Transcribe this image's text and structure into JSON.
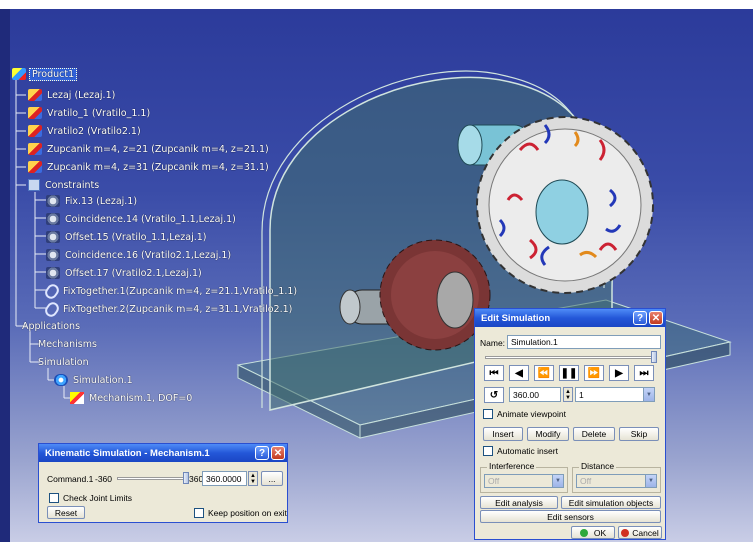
{
  "tree": {
    "root": "Product1",
    "items": [
      {
        "label": "Lezaj (Lezaj.1)",
        "icon": "part-icon"
      },
      {
        "label": "Vratilo_1 (Vratilo_1.1)",
        "icon": "part-icon"
      },
      {
        "label": "Vratilo2 (Vratilo2.1)",
        "icon": "part-icon"
      },
      {
        "label": "Zupcanik  m=4, z=21 (Zupcanik  m=4, z=21.1)",
        "icon": "part-icon"
      },
      {
        "label": "Zupcanik  m=4, z=31 (Zupcanik  m=4, z=31.1)",
        "icon": "part-icon"
      }
    ],
    "constraints_label": "Constraints",
    "constraints": [
      {
        "label": "Fix.13 (Lezaj.1)",
        "icon": "fix-constraint-icon"
      },
      {
        "label": "Coincidence.14 (Vratilo_1.1,Lezaj.1)",
        "icon": "coincidence-constraint-icon"
      },
      {
        "label": "Offset.15 (Vratilo_1.1,Lezaj.1)",
        "icon": "offset-constraint-icon"
      },
      {
        "label": "Coincidence.16 (Vratilo2.1,Lezaj.1)",
        "icon": "coincidence-constraint-icon"
      },
      {
        "label": "Offset.17 (Vratilo2.1,Lezaj.1)",
        "icon": "offset-constraint-icon"
      },
      {
        "label": "FixTogether.1(Zupcanik  m=4, z=21.1,Vratilo_1.1)",
        "icon": "fix-together-icon"
      },
      {
        "label": "FixTogether.2(Zupcanik  m=4, z=31.1,Vratilo2.1)",
        "icon": "fix-together-icon"
      }
    ],
    "applications_label": "Applications",
    "mechanisms_label": "Mechanisms",
    "simulation_label": "Simulation",
    "simulation_item": "Simulation.1",
    "mechanism_item": "Mechanism.1, DOF=0"
  },
  "kinematic_dialog": {
    "title": "Kinematic Simulation - Mechanism.1",
    "command_label": "Command.1",
    "min_value": "-360",
    "max_value": "360",
    "current_value": "360.0000",
    "slider_fraction": 1.0,
    "more_button": "...",
    "check_joint_limits": "Check Joint Limits",
    "reset_button": "Reset",
    "keep_position": "Keep position on exit"
  },
  "edit_simulation": {
    "title": "Edit Simulation",
    "name_label": "Name:",
    "name_value": "Simulation.1",
    "slider_fraction": 1.0,
    "play_buttons": [
      {
        "icon": "jump-to-start-icon",
        "glyph": "⏮"
      },
      {
        "icon": "step-back-icon",
        "glyph": "◀"
      },
      {
        "icon": "skip-back-icon",
        "glyph": "⏪"
      },
      {
        "icon": "pause-icon",
        "glyph": "❚❚"
      },
      {
        "icon": "skip-forward-icon",
        "glyph": "⏩"
      },
      {
        "icon": "play-icon",
        "glyph": "▶"
      },
      {
        "icon": "jump-to-end-icon",
        "glyph": "⏭"
      }
    ],
    "time_value": "360.00",
    "step_value": "1",
    "animate_viewpoint": "Animate viewpoint",
    "insert_button": "Insert",
    "modify_button": "Modify",
    "delete_button": "Delete",
    "skip_button": "Skip",
    "automatic_insert": "Automatic insert",
    "interference_label": "Interference",
    "interference_value": "Off",
    "distance_label": "Distance",
    "distance_value": "Off",
    "edit_analysis_button": "Edit analysis",
    "edit_sim_objects_button": "Edit simulation objects",
    "edit_sensors_button": "Edit sensors",
    "ok_button": "OK",
    "cancel_button": "Cancel"
  },
  "colors": {
    "title_bar": "#2457d8",
    "dialog_bg": "#ece9d8",
    "selection": "#3161d8",
    "ok_green": "#2fa83a",
    "cancel_red": "#d03020"
  }
}
